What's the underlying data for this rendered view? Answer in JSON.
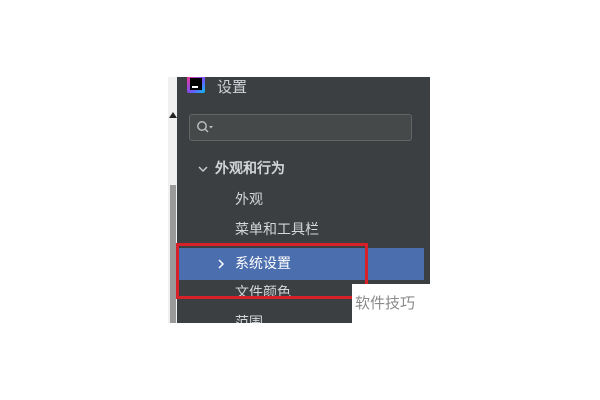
{
  "panel": {
    "title": "设置",
    "logo_icon": "jetbrains-logo-icon"
  },
  "search": {
    "placeholder": "",
    "icon": "search-icon"
  },
  "tree": {
    "group_label": "外观和行为",
    "items": [
      {
        "label": "外观"
      },
      {
        "label": "菜单和工具栏"
      },
      {
        "label": "系统设置",
        "selected": true
      },
      {
        "label": "文件颜色"
      },
      {
        "label": "范围"
      }
    ]
  },
  "colors": {
    "panel_bg": "#3c3f41",
    "selection": "#4b6eaf",
    "highlight_border": "#d6202a"
  },
  "watermark": {
    "text": "软件技巧"
  }
}
